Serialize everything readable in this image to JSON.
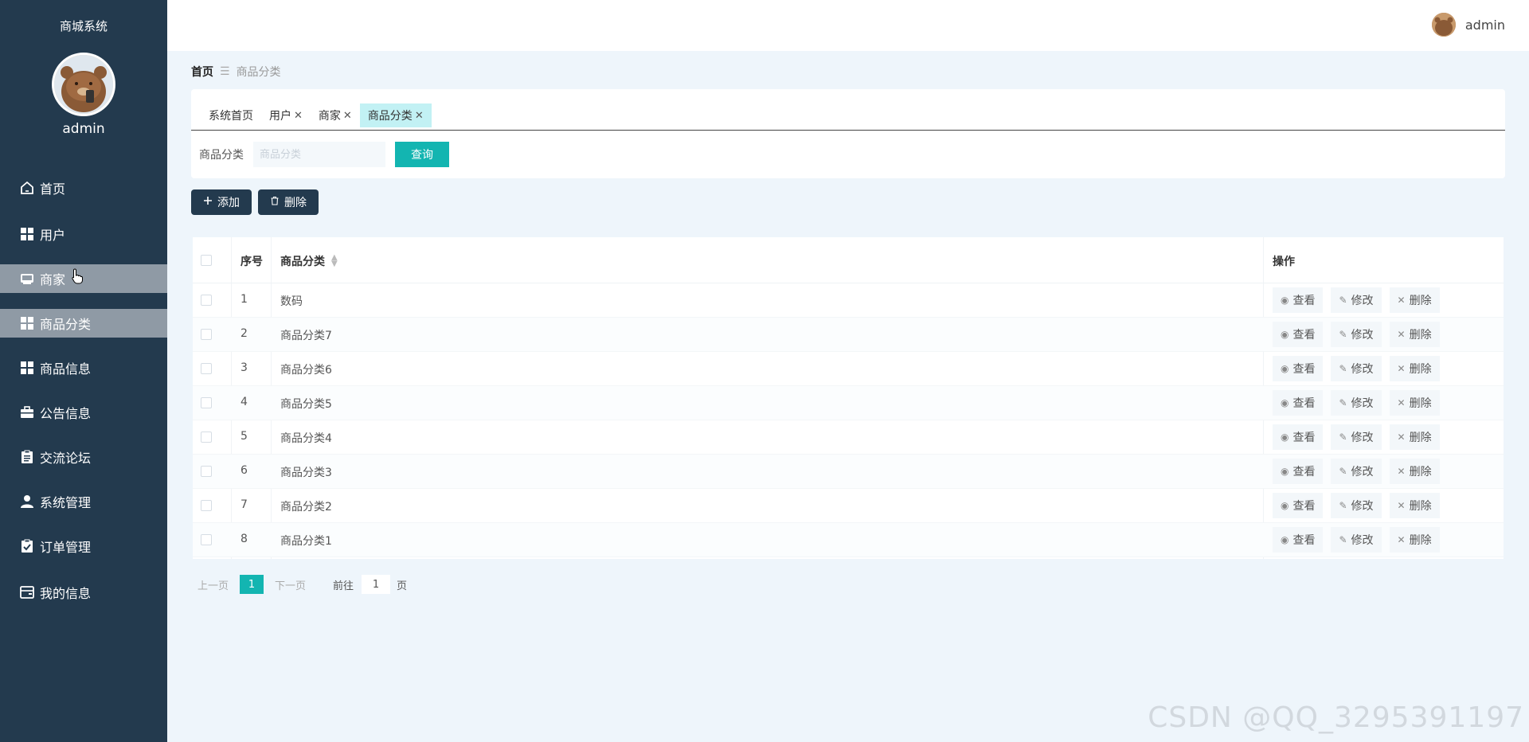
{
  "app": {
    "title": "商城系统",
    "user": "admin"
  },
  "sidebar": {
    "items": [
      {
        "label": "首页",
        "icon": "home-icon"
      },
      {
        "label": "用户",
        "icon": "grid-icon"
      },
      {
        "label": "商家",
        "icon": "inbox-icon"
      },
      {
        "label": "商品分类",
        "icon": "grid-icon"
      },
      {
        "label": "商品信息",
        "icon": "grid-icon"
      },
      {
        "label": "公告信息",
        "icon": "briefcase-icon"
      },
      {
        "label": "交流论坛",
        "icon": "clipboard-icon"
      },
      {
        "label": "系统管理",
        "icon": "user-icon"
      },
      {
        "label": "订单管理",
        "icon": "clipboard-check-icon"
      },
      {
        "label": "我的信息",
        "icon": "wallet-icon"
      }
    ]
  },
  "topbar": {
    "username": "admin"
  },
  "breadcrumb": {
    "home": "首页",
    "separator": "☰",
    "current": "商品分类"
  },
  "tabs": [
    {
      "label": "系统首页",
      "closable": false
    },
    {
      "label": "用户",
      "closable": true
    },
    {
      "label": "商家",
      "closable": true
    },
    {
      "label": "商品分类",
      "closable": true
    }
  ],
  "search": {
    "label": "商品分类",
    "placeholder": "商品分类",
    "button": "查询"
  },
  "actions": {
    "add": "添加",
    "delete": "删除"
  },
  "table": {
    "columns": {
      "no": "序号",
      "category": "商品分类",
      "ops": "操作"
    },
    "rows": [
      {
        "no": "1",
        "category": "数码"
      },
      {
        "no": "2",
        "category": "商品分类7"
      },
      {
        "no": "3",
        "category": "商品分类6"
      },
      {
        "no": "4",
        "category": "商品分类5"
      },
      {
        "no": "5",
        "category": "商品分类4"
      },
      {
        "no": "6",
        "category": "商品分类3"
      },
      {
        "no": "7",
        "category": "商品分类2"
      },
      {
        "no": "8",
        "category": "商品分类1"
      }
    ],
    "op_labels": {
      "view": "查看",
      "edit": "修改",
      "delete": "删除"
    }
  },
  "pagination": {
    "prev": "上一页",
    "current": "1",
    "next": "下一页",
    "goto": "前往",
    "goto_value": "1",
    "unit": "页"
  },
  "watermark": "CSDN @QQ_3295391197",
  "colors": {
    "sidebar": "#233a4e",
    "accent": "#13b5b1",
    "active_tab": "#c2f1f4"
  }
}
